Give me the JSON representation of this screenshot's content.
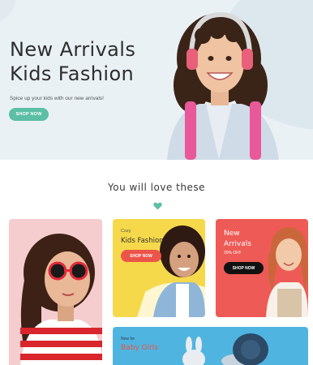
{
  "hero": {
    "title_line1": "New Arrivals",
    "title_line2": "Kids Fashion",
    "subtitle": "Spice up your kids with our new arrivals!",
    "button_label": "SHOP NOW",
    "accent": "#5cbfa6",
    "background": "#eaf1f5"
  },
  "section": {
    "title": "You will love these",
    "heart_color": "#5cbfa6"
  },
  "cards": {
    "kids": {
      "eyebrow": "Cozy",
      "title": "Kids Fashion",
      "button_label": "SHOP NOW",
      "background": "#f5d94a"
    },
    "arrivals": {
      "title_line1": "New",
      "title_line2": "Arrivals",
      "discount": "20% OFF",
      "button_label": "SHOP NOW",
      "background": "#ee5a55"
    },
    "baby": {
      "eyebrow": "New for",
      "title": "Baby Girls",
      "background": "#50b4e0"
    },
    "girl_sunglasses": {
      "background": "#f6cdcf"
    }
  }
}
